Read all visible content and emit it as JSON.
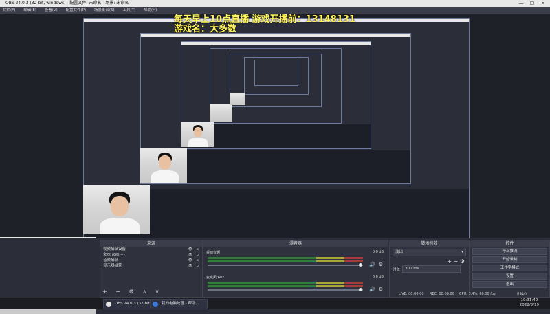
{
  "window": {
    "title": "OBS 24.0.3 (32-bit, windows) - 配置文件: 未命名 - 场景: 未命名",
    "controls": [
      "—",
      "☐",
      "✕"
    ]
  },
  "menu": [
    "文件(F)",
    "编辑(E)",
    "查看(V)",
    "配置文件(P)",
    "场景集合(S)",
    "工具(T)",
    "帮助(H)"
  ],
  "overlay": {
    "line1": "每天早上10点直播   游戏开播前：13148131",
    "line2": "游戏名：大多数"
  },
  "docks": {
    "sources_title": "来源",
    "mixer_title": "混音器",
    "transitions_title": "转场特效",
    "controls_title": "控件",
    "sources": [
      "视频捕获设备",
      "文本 (GDI+)",
      "音频捕获",
      "显示器捕获"
    ],
    "source_toolbar": "+ − ⚙ ∧ ∨",
    "mixer": [
      {
        "name": "桌面音频",
        "db": "0.0 dB"
      },
      {
        "name": "麦克风/Aux",
        "db": "0.0 dB"
      }
    ],
    "transition": {
      "value": "淡出",
      "duration_label": "时长",
      "duration_value": "300 ms"
    },
    "controls": [
      "停止推流",
      "开始录制",
      "工作室模式",
      "设置",
      "退出"
    ]
  },
  "status": {
    "live": "LIVE: 00:00:00",
    "rec": "REC: 00:00:00",
    "cpu": "CPU: 3.4%, 60.00 fps",
    "kbps": "0 kb/s"
  },
  "taskbar": {
    "items": [
      "OBS 24.0.3 (32-bit...",
      "我的电脑处理 - 帮助..."
    ],
    "time": "10:31:42",
    "date": "2022/3/19"
  },
  "colors": {
    "overlay_text": "#fff35a",
    "obs_bg": "#2b2e38",
    "accent_border": "#6a7aa0"
  }
}
